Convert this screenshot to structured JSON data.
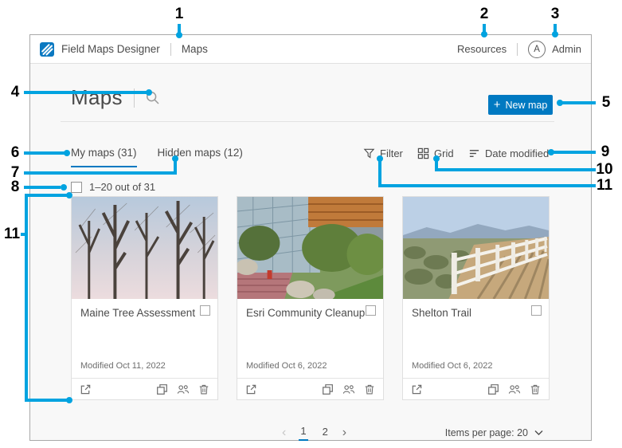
{
  "header": {
    "app_title": "Field Maps Designer",
    "nav_item": "Maps",
    "resources_label": "Resources",
    "avatar_initial": "A",
    "user_label": "Admin"
  },
  "toolbar": {
    "page_title": "Maps",
    "new_map_plus": "+",
    "new_map_label": "New map"
  },
  "tabs": {
    "my_maps": "My maps (31)",
    "hidden_maps": "Hidden maps (12)"
  },
  "list_controls": {
    "filter_label": "Filter",
    "grid_label": "Grid",
    "sort_label": "Date modified",
    "count_label": "1–20 out of 31"
  },
  "cards": [
    {
      "title": "Maine Tree Assessment",
      "modified": "Modified Oct 11, 2022"
    },
    {
      "title": "Esri Community Cleanup",
      "modified": "Modified Oct 6, 2022"
    },
    {
      "title": "Shelton Trail",
      "modified": "Modified Oct 6, 2022"
    }
  ],
  "pagination": {
    "prev": "‹",
    "page1": "1",
    "page2": "2",
    "next": "›",
    "items_per_page_label": "Items per page: 20"
  },
  "callouts": {
    "n1": "1",
    "n2": "2",
    "n3": "3",
    "n4": "4",
    "n5": "5",
    "n6": "6",
    "n7": "7",
    "n8": "8",
    "n9": "9",
    "n10": "10",
    "n11": "11"
  },
  "colors": {
    "accent_blue": "#0079c1",
    "callout_cyan": "#00a3e0"
  }
}
